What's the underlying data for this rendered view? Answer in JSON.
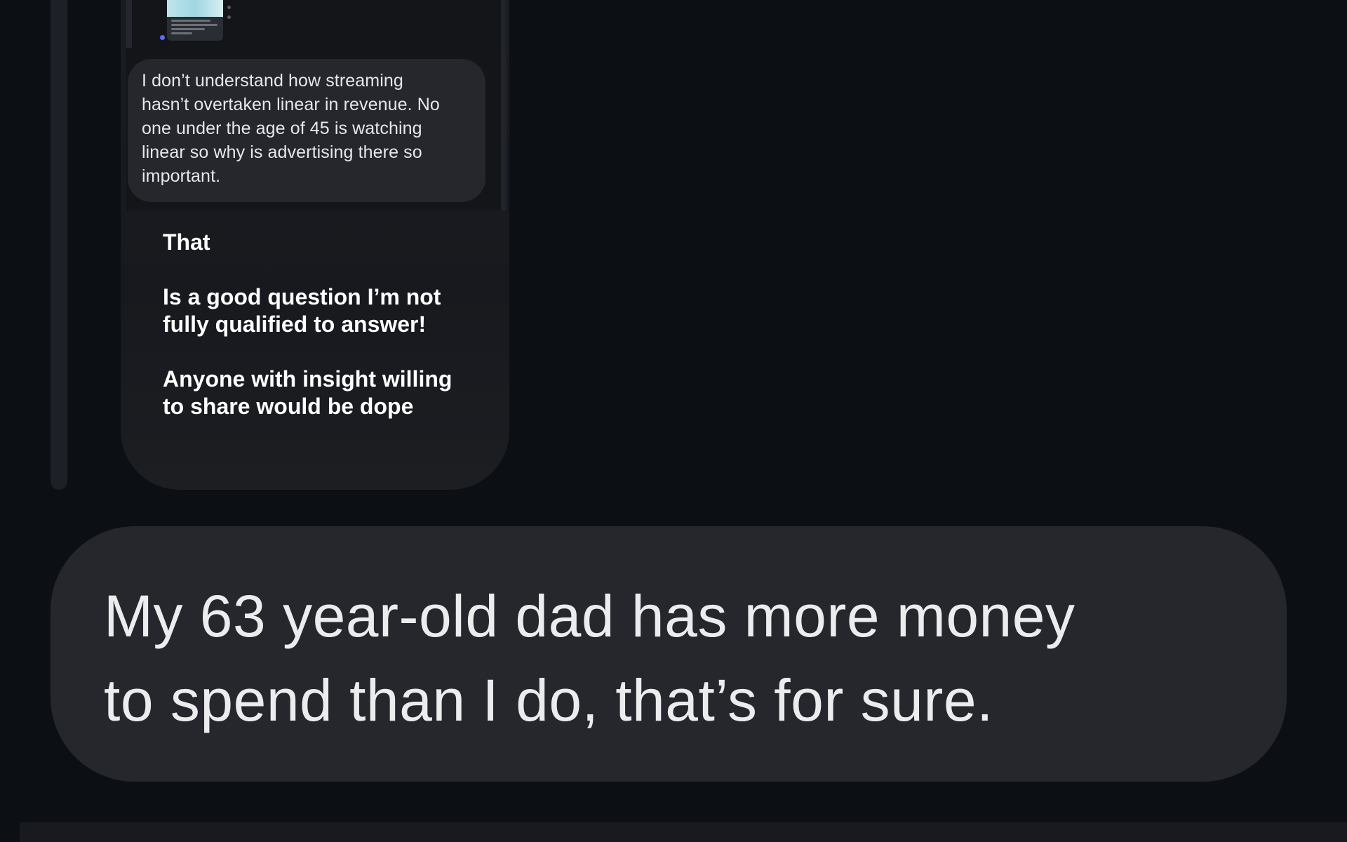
{
  "thread": {
    "quoted_reply": {
      "text": "I don’t understand how streaming\nhasn’t overtaken linear in revenue. No\none under the age of 45 is watching\nlinear so why is advertising there so\nimportant."
    },
    "caption": {
      "line1": "That",
      "line2": "Is a good question I’m not\nfully qualified to answer!",
      "line3": "Anyone with insight willing\nto share would be dope"
    }
  },
  "main_comment": {
    "text": "My 63 year-old dad has more money\nto spend than I do, that’s for sure."
  },
  "colors": {
    "background": "#0c0f14",
    "bubble": "#25272c",
    "text": "#ececee"
  }
}
